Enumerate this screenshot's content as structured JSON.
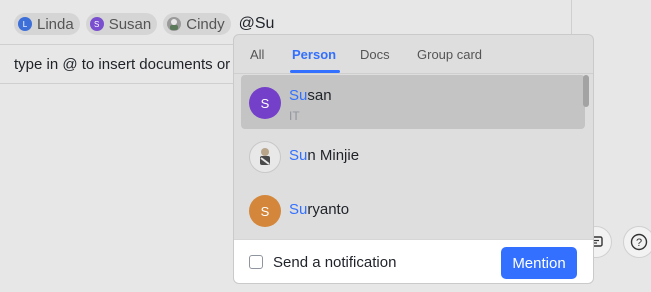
{
  "editor": {
    "tags": [
      {
        "label": "Linda",
        "avatar_letter": "L",
        "avatar_color": "#3d6fd8"
      },
      {
        "label": "Susan",
        "avatar_letter": "S",
        "avatar_color": "#7a4fcf"
      },
      {
        "label": "Cindy",
        "avatar_letter": "",
        "avatar_color": "#9a9a9a"
      }
    ],
    "typed_text": "@Su",
    "hint_text": "type in @ to insert documents or f"
  },
  "popup": {
    "tabs": [
      {
        "label": "All",
        "active": false
      },
      {
        "label": "Person",
        "active": true
      },
      {
        "label": "Docs",
        "active": false
      },
      {
        "label": "Group card",
        "active": false
      }
    ],
    "results": [
      {
        "avatar_letter": "S",
        "avatar_color": "#7440c9",
        "name_match": "Su",
        "name_rest": "san",
        "subtitle": "IT",
        "selected": true
      },
      {
        "avatar_letter": "",
        "avatar_color": "#e8e8e8",
        "name_match": "Su",
        "name_rest": "n Minjie",
        "subtitle": "",
        "selected": false
      },
      {
        "avatar_letter": "S",
        "avatar_color": "#d4863a",
        "name_match": "Su",
        "name_rest": "ryanto",
        "subtitle": "",
        "selected": false
      }
    ],
    "footer": {
      "notify_label": "Send a notification",
      "notify_checked": false,
      "mention_label": "Mention"
    }
  },
  "colors": {
    "accent": "#3370ff"
  }
}
